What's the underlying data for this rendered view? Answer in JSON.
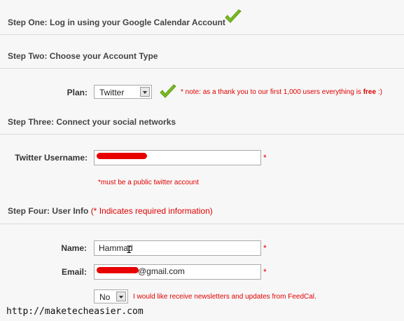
{
  "steps": {
    "one": "Step One: Log in using your Google Calendar Account",
    "two": "Step Two: Choose your Account Type",
    "three": "Step Three: Connect your social networks",
    "four_prefix": "Step Four: User Info",
    "four_required": "(* Indicates required information)"
  },
  "plan": {
    "label": "Plan:",
    "selected": "Twitter",
    "note_prefix": "* note: as a thank you to our first 1,000 users everything is ",
    "note_bold": "free",
    "note_suffix": " :)"
  },
  "twitter": {
    "label": "Twitter Username:",
    "value": "",
    "required_mark": "*",
    "hint": "*must be a public twitter account"
  },
  "user": {
    "name_label": "Name:",
    "name_value": "Hammad",
    "email_label": "Email:",
    "email_value": "@gmail.com",
    "required_mark": "*"
  },
  "newsletter": {
    "selected": "No",
    "text": "I would like receive newsletters and updates from FeedCal."
  },
  "watermark": "http://maketecheasier.com",
  "colors": {
    "required_red": "#e00000",
    "check_green": "#6fae1c"
  }
}
